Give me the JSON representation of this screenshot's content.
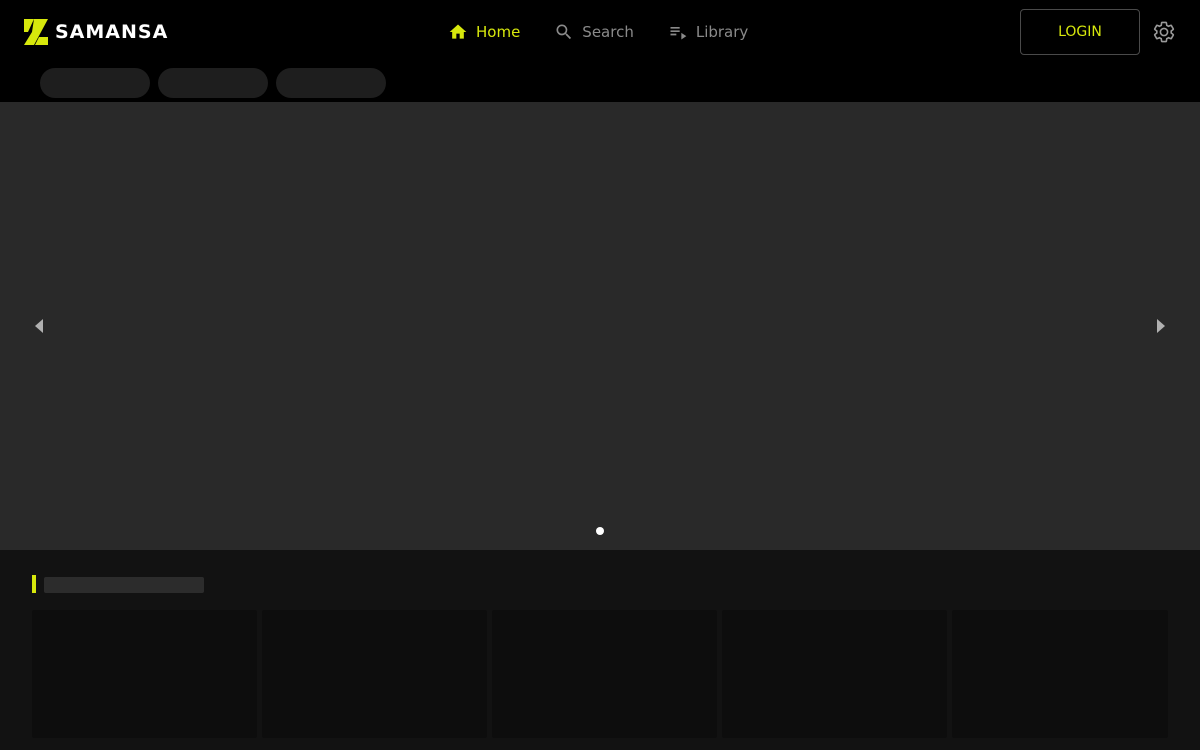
{
  "header": {
    "brand": "SAMANSA",
    "nav": {
      "home_label": "Home",
      "search_label": "Search",
      "library_label": "Library"
    },
    "login_label": "LOGIN"
  },
  "icons": {
    "logo": "samansa-logo-icon",
    "home": "home-icon",
    "search": "search-icon",
    "library": "playlist-icon",
    "settings": "gear-icon",
    "prev": "chevron-left-icon",
    "next": "chevron-right-icon"
  },
  "colors": {
    "accent": "#d7e80c",
    "background": "#000000",
    "hero_placeholder": "#292929",
    "section_background": "#121212",
    "inactive_nav": "#8a8a8a"
  },
  "carousel": {
    "slide_count": 1,
    "active_slide": 1
  }
}
